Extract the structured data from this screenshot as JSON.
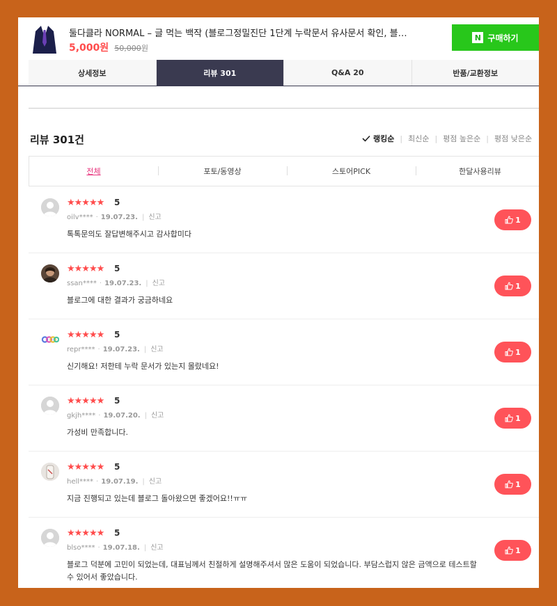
{
  "product": {
    "title": "둘다클라 NORMAL – 글 먹는 백작 (블로그정밀진단 1단계 누락문서 유사문서 확인, 블…",
    "price": "5,000원",
    "original_price_num": "50,000",
    "original_price_unit": "원",
    "buy_label": "구매하기",
    "buy_badge": "N"
  },
  "tabs": [
    "상세정보",
    "리뷰 301",
    "Q&A 20",
    "반품/교환정보"
  ],
  "reviews_header": {
    "title": "리뷰 301건",
    "sorts": [
      "랭킹순",
      "최신순",
      "평점 높은순",
      "평점 낮은순"
    ]
  },
  "filters": [
    "전체",
    "포토/동영상",
    "스토어PICK",
    "한달사용리뷰"
  ],
  "stars_glyph": "★★★★★",
  "report_label": "신고",
  "reviews": [
    {
      "score": "5",
      "user": "oilv****",
      "date": "19.07.23.",
      "text": "톡톡문의도 잘답변해주시고 감사합미다",
      "likes": "1",
      "avatar": "default"
    },
    {
      "score": "5",
      "user": "ssan****",
      "date": "19.07.23.",
      "text": "블로그에 대한 결과가 궁금하네요",
      "likes": "1",
      "avatar": "photo-dark"
    },
    {
      "score": "5",
      "user": "repr****",
      "date": "19.07.23.",
      "text": "신기해요! 저한테 누락 문서가 있는지 몰랐네요!",
      "likes": "1",
      "avatar": "yolo"
    },
    {
      "score": "5",
      "user": "gkjh****",
      "date": "19.07.20.",
      "text": "가성비 만족합니다.",
      "likes": "1",
      "avatar": "default"
    },
    {
      "score": "5",
      "user": "hell****",
      "date": "19.07.19.",
      "text": "지금 진행되고 있는데 블로그 돌아왔으면 좋겠어요!!ㅠㅠ",
      "likes": "1",
      "avatar": "photo-light"
    },
    {
      "score": "5",
      "user": "blso****",
      "date": "19.07.18.",
      "text": "블로그 덕분에 고민이 되었는데, 대표님께서 친절하게 설명해주셔서 많은 도움이 되었습니다. 부담스럽지 않은 금액으로 테스트할 수 있어서 좋았습니다.",
      "likes": "1",
      "avatar": "default"
    }
  ],
  "colors": {
    "accent": "#ff4c4c",
    "active_tab": "#3a3a50",
    "buy": "#28c71b",
    "filter_active": "#e8337c",
    "frame": "#c8631b"
  }
}
